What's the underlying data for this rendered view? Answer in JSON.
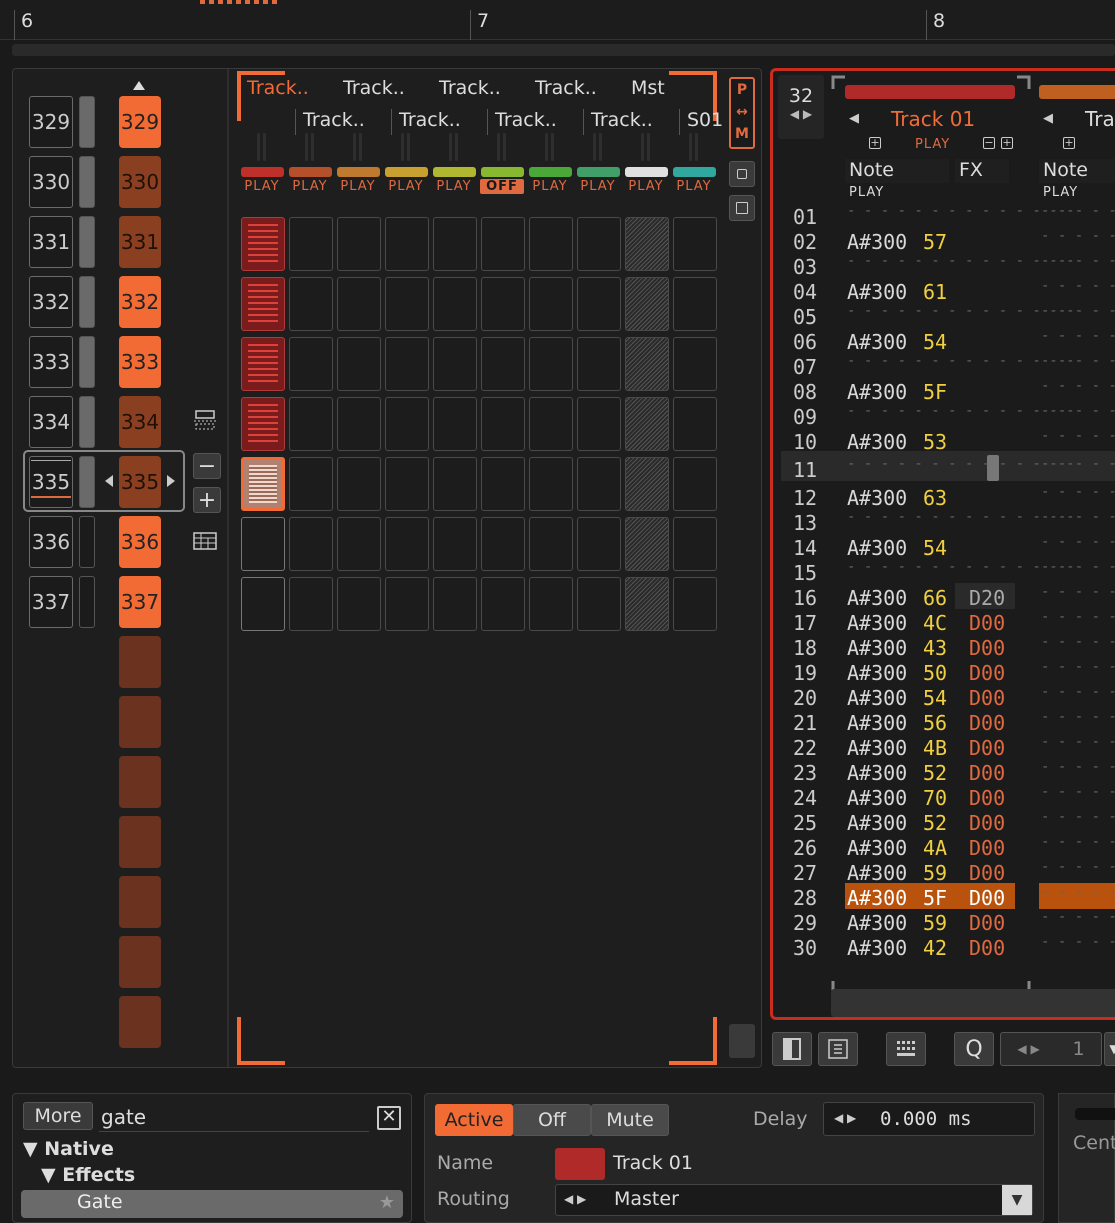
{
  "timeline": {
    "markers": [
      "6",
      "7",
      "8"
    ]
  },
  "sequence": {
    "numbers": [
      "329",
      "330",
      "331",
      "332",
      "333",
      "334",
      "335",
      "336",
      "337"
    ],
    "slots": [
      "329",
      "330",
      "331",
      "332",
      "333",
      "334",
      "335",
      "336",
      "337",
      "",
      "",
      "",
      "",
      "",
      "",
      ""
    ]
  },
  "matrix": {
    "tracks_top": [
      "Track..",
      "Track..",
      "Track..",
      "Track..",
      "Mst"
    ],
    "tracks_bottom": [
      "Track..",
      "Track..",
      "Track..",
      "Track..",
      "S01"
    ],
    "play_labels": [
      "PLAY",
      "PLAY",
      "PLAY",
      "PLAY",
      "PLAY",
      "OFF",
      "PLAY",
      "PLAY",
      "PLAY",
      "PLAY"
    ],
    "colors": [
      "#c0302a",
      "#b5502a",
      "#c07a30",
      "#c8a030",
      "#b0b830",
      "#88b830",
      "#4aa838",
      "#40a068",
      "#e0e0e0",
      "#30a8a0"
    ],
    "side_labels": {
      "p": "P",
      "arrows": "↔",
      "m": "M"
    }
  },
  "pattern": {
    "lines_per_pattern": "32",
    "track1_name": "Track 01",
    "track1_color": "#b02a2a",
    "track2_name": "Tra",
    "track2_color": "#c06020",
    "play": "PLAY",
    "col_note": "Note",
    "col_fx": "FX",
    "rows": [
      {
        "ln": "01",
        "nt": "",
        "vl": "",
        "fx": ""
      },
      {
        "ln": "02",
        "nt": "A#300",
        "vl": "57",
        "fx": ""
      },
      {
        "ln": "03",
        "nt": "",
        "vl": "",
        "fx": ""
      },
      {
        "ln": "04",
        "nt": "A#300",
        "vl": "61",
        "fx": ""
      },
      {
        "ln": "05",
        "nt": "",
        "vl": "",
        "fx": ""
      },
      {
        "ln": "06",
        "nt": "A#300",
        "vl": "54",
        "fx": ""
      },
      {
        "ln": "07",
        "nt": "",
        "vl": "",
        "fx": ""
      },
      {
        "ln": "08",
        "nt": "A#300",
        "vl": "5F",
        "fx": ""
      },
      {
        "ln": "09",
        "nt": "",
        "vl": "",
        "fx": ""
      },
      {
        "ln": "10",
        "nt": "A#300",
        "vl": "53",
        "fx": ""
      },
      {
        "ln": "11",
        "nt": "",
        "vl": "",
        "fx": ""
      },
      {
        "ln": "12",
        "nt": "A#300",
        "vl": "63",
        "fx": ""
      },
      {
        "ln": "13",
        "nt": "",
        "vl": "",
        "fx": ""
      },
      {
        "ln": "14",
        "nt": "A#300",
        "vl": "54",
        "fx": ""
      },
      {
        "ln": "15",
        "nt": "",
        "vl": "",
        "fx": ""
      },
      {
        "ln": "16",
        "nt": "A#300",
        "vl": "66",
        "fx": "D20"
      },
      {
        "ln": "17",
        "nt": "A#300",
        "vl": "4C",
        "fx": "D00"
      },
      {
        "ln": "18",
        "nt": "A#300",
        "vl": "43",
        "fx": "D00"
      },
      {
        "ln": "19",
        "nt": "A#300",
        "vl": "50",
        "fx": "D00"
      },
      {
        "ln": "20",
        "nt": "A#300",
        "vl": "54",
        "fx": "D00"
      },
      {
        "ln": "21",
        "nt": "A#300",
        "vl": "56",
        "fx": "D00"
      },
      {
        "ln": "22",
        "nt": "A#300",
        "vl": "4B",
        "fx": "D00"
      },
      {
        "ln": "23",
        "nt": "A#300",
        "vl": "52",
        "fx": "D00"
      },
      {
        "ln": "24",
        "nt": "A#300",
        "vl": "70",
        "fx": "D00"
      },
      {
        "ln": "25",
        "nt": "A#300",
        "vl": "52",
        "fx": "D00"
      },
      {
        "ln": "26",
        "nt": "A#300",
        "vl": "4A",
        "fx": "D00"
      },
      {
        "ln": "27",
        "nt": "A#300",
        "vl": "59",
        "fx": "D00"
      },
      {
        "ln": "28",
        "nt": "A#300",
        "vl": "5F",
        "fx": "D00"
      },
      {
        "ln": "29",
        "nt": "A#300",
        "vl": "59",
        "fx": "D00"
      },
      {
        "ln": "30",
        "nt": "A#300",
        "vl": "42",
        "fx": "D00"
      }
    ],
    "toolbar_value": "1"
  },
  "browser": {
    "more_label": "More",
    "search_value": "gate",
    "tree": {
      "native": "Native",
      "effects": "Effects",
      "gate": "Gate"
    }
  },
  "props": {
    "active": "Active",
    "off": "Off",
    "mute": "Mute",
    "delay_label": "Delay",
    "delay_value": "0.000 ms",
    "name_label": "Name",
    "name_value": "Track 01",
    "routing_label": "Routing",
    "routing_value": "Master"
  },
  "right": {
    "label": "Cent"
  }
}
